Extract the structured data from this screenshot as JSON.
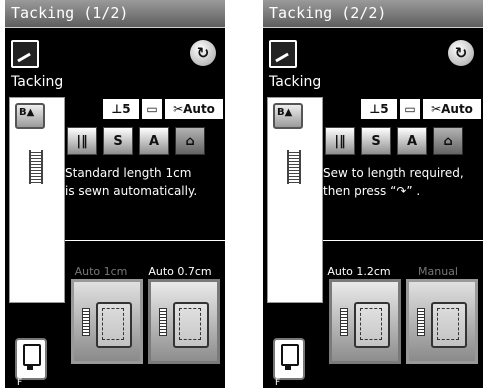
{
  "panels": [
    {
      "title": "Tacking (1/2)",
      "subtitle": "Tacking",
      "strip_button": "B▲",
      "chips": [
        "⊥5",
        "▭",
        "✂Auto"
      ],
      "icons": [
        "stitch-width-icon",
        "pattern-icon",
        "letter-a-icon",
        "shirt-icon"
      ],
      "icon_glyphs": [
        "|‖",
        "S",
        "A",
        "⌂"
      ],
      "message_lines": [
        "Standard length 1cm",
        "is sewn automatically."
      ],
      "tabs": [
        {
          "label": "Auto 1cm",
          "active": false
        },
        {
          "label": "Auto 0.7cm",
          "active": true
        }
      ],
      "footer_label": "F"
    },
    {
      "title": "Tacking (2/2)",
      "subtitle": "Tacking",
      "strip_button": "B▲",
      "chips": [
        "⊥5",
        "▭",
        "✂Auto"
      ],
      "icons": [
        "stitch-width-icon",
        "pattern-icon",
        "letter-a-icon",
        "shirt-icon"
      ],
      "icon_glyphs": [
        "|‖",
        "S",
        "A",
        "⌂"
      ],
      "message_lines": [
        "Sew to length required,",
        "then press “↷” ."
      ],
      "tabs": [
        {
          "label": "Auto 1.2cm",
          "active": true
        },
        {
          "label": "Manual",
          "active": false
        }
      ],
      "footer_label": "F",
      "side_arrow": "↷"
    }
  ]
}
